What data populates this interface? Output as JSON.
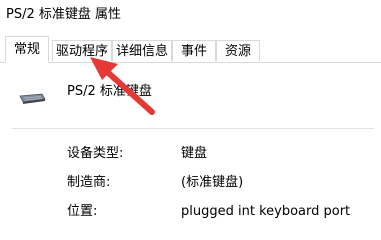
{
  "window": {
    "title": "PS/2 标准键盘 属性"
  },
  "tabs": [
    {
      "label": "常规",
      "active": true
    },
    {
      "label": "驱动程序",
      "active": false
    },
    {
      "label": "详细信息",
      "active": false
    },
    {
      "label": "事件",
      "active": false
    },
    {
      "label": "资源",
      "active": false
    }
  ],
  "device": {
    "icon": "keyboard-icon",
    "name": "PS/2 标准键盘"
  },
  "properties": [
    {
      "label": "设备类型:",
      "value": "键盘"
    },
    {
      "label": "制造商:",
      "value": "(标准键盘)"
    },
    {
      "label": "位置:",
      "value": "plugged int   keyboard port"
    }
  ],
  "annotation": {
    "icon": "red-arrow-icon",
    "color": "#e53935"
  }
}
